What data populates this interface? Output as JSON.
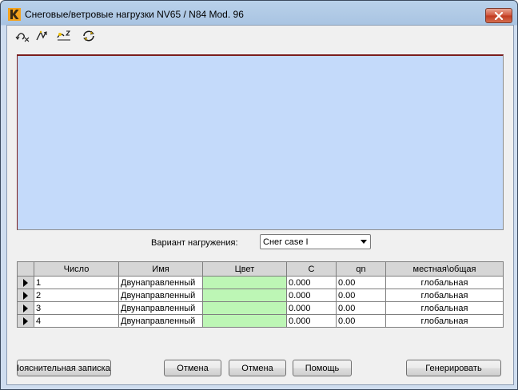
{
  "window": {
    "title": "Снеговые/ветровые нагрузки  NV65 / N84 Mod. 96"
  },
  "toolbar": {
    "items": [
      {
        "icon": "reset-axis-icon"
      },
      {
        "icon": "direction-icon"
      },
      {
        "icon": "zoom-z-icon"
      },
      {
        "icon": "refresh-rotate-icon"
      }
    ]
  },
  "variant": {
    "label": "Вариант нагружения:",
    "selected": "Снег case I"
  },
  "table": {
    "headers": [
      "",
      "Число",
      "Имя",
      "Цвет",
      "C",
      "qn",
      "местная\\общая"
    ],
    "rows": [
      {
        "num": "1",
        "name": "Двунаправленный",
        "color": "#bdf6b5",
        "c": "0.000",
        "qn": "0.00",
        "scope": "глобальная"
      },
      {
        "num": "2",
        "name": "Двунаправленный",
        "color": "#bdf6b5",
        "c": "0.000",
        "qn": "0.00",
        "scope": "глобальная"
      },
      {
        "num": "3",
        "name": "Двунаправленный",
        "color": "#bdf6b5",
        "c": "0.000",
        "qn": "0.00",
        "scope": "глобальная"
      },
      {
        "num": "4",
        "name": "Двунаправленный",
        "color": "#bdf6b5",
        "c": "0.000",
        "qn": "0.00",
        "scope": "глобальная"
      }
    ]
  },
  "buttons": {
    "note": "Пояснительная записка",
    "cancel1": "Отмена",
    "cancel2": "Отмена",
    "help": "Помощь",
    "generate": "Генерировать"
  },
  "colors": {
    "canvas": "#c4dafa",
    "canvas_border": "#7b1e1e",
    "row_color": "#bdf6b5",
    "titlebar": "#b9d1ea"
  }
}
